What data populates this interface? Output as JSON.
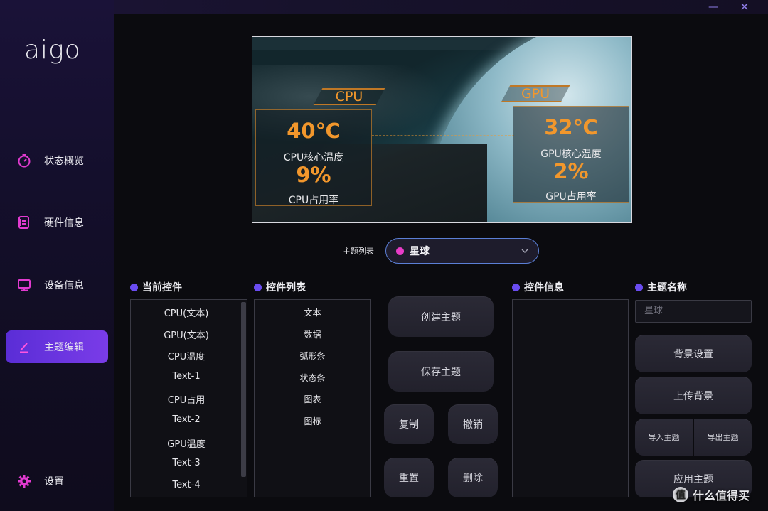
{
  "window": {
    "min_glyph": "—",
    "close_glyph": "✕"
  },
  "brand": {
    "logo": "aigo"
  },
  "sidebar": {
    "items": [
      {
        "label": "状态概览",
        "icon": "gauge-icon",
        "active": false
      },
      {
        "label": "硬件信息",
        "icon": "document-icon",
        "active": false
      },
      {
        "label": "设备信息",
        "icon": "monitor-icon",
        "active": false
      },
      {
        "label": "主题编辑",
        "icon": "pencil-icon",
        "active": true
      },
      {
        "label": "设置",
        "icon": "gear-icon",
        "active": false
      }
    ],
    "accent": "#e23ad0"
  },
  "preview": {
    "cpu": {
      "tab": "CPU",
      "temp": "40℃",
      "temp_label": "CPU核心温度",
      "usage": "9%",
      "usage_label": "CPU占用率"
    },
    "gpu": {
      "tab": "GPU",
      "temp": "32℃",
      "temp_label": "GPU核心温度",
      "usage": "2%",
      "usage_label": "GPU占用率"
    },
    "accent": "#f2972c"
  },
  "theme": {
    "label": "主题列表",
    "selected": "星球",
    "dot_color": "#e83cc8"
  },
  "sections": {
    "current": "当前控件",
    "list": "控件列表",
    "info": "控件信息",
    "name": "主题名称"
  },
  "current_widgets": [
    "CPU(文本)",
    "GPU(文本)",
    "CPU温度",
    "Text-1",
    "CPU占用",
    "Text-2",
    "GPU温度",
    "Text-3",
    "Text-4"
  ],
  "widget_list": [
    "文本",
    "数据",
    "弧形条",
    "状态条",
    "图表",
    "图标"
  ],
  "buttons": {
    "create": "创建主题",
    "save": "保存主题",
    "copy": "复制",
    "undo": "撤销",
    "reset": "重置",
    "delete": "删除",
    "bg_settings": "背景设置",
    "upload_bg": "上传背景",
    "import": "导入主题",
    "export": "导出主题",
    "apply": "应用主题"
  },
  "theme_name_placeholder": "星球",
  "watermark": {
    "glyph": "值",
    "text": "什么值得买"
  }
}
